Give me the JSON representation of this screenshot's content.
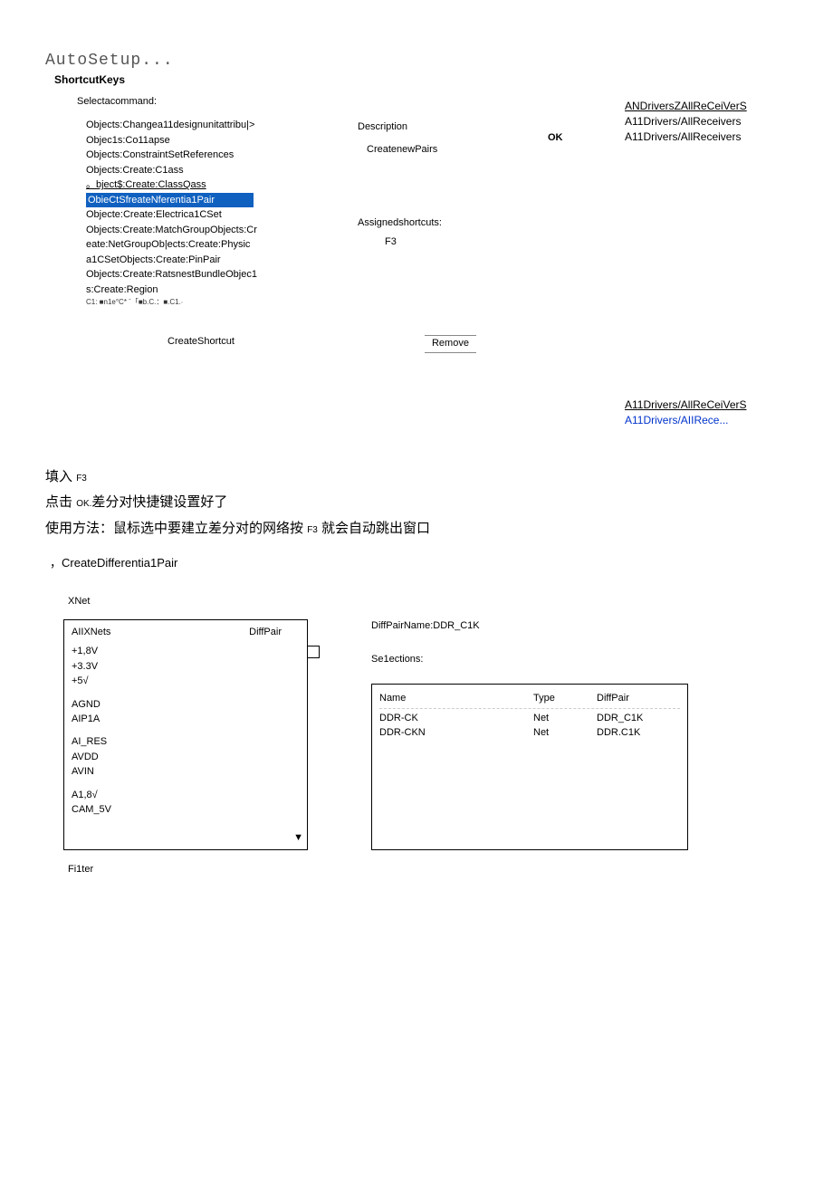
{
  "header": {
    "autosetup": "AutoSetup...",
    "shortcutkeys": "ShortcutKeys"
  },
  "sidebar1": {
    "l1": "ANDriversZAllReCeiVerS",
    "l2": "A11Drivers/AllReceivers",
    "l3": "A11Drivers/AllReceivers"
  },
  "dialog": {
    "select_label": "Selectacommand:",
    "cmds": {
      "c1": "Objects:Changea11designunitattribu|>",
      "c2": "Objec1s:Co11apse",
      "c3": "Objects:ConstraintSetReferences",
      "c4": "Objects:Create:C1ass",
      "c5": "。bject$:Create:ClassQass",
      "c6": "ObieCtSfreateNferentia1Pair",
      "c7": "Objecte:Create:Electrica1CSet",
      "c8": "Objects:Create:MatchGroupObjects:Cr",
      "c9": "eate:NetGroupOb|ects:Create:Physic",
      "c10": "a1CSetObjects:Create:PinPair",
      "c11": "Objects:Create:RatsnestBundleObjec1",
      "c12": "s:Create:Region",
      "c13": "C1: ■n1e°C* ˉ「■b.C.：■.C1.∙"
    },
    "desc_label": "Description",
    "desc_body": "CreatenewPairs",
    "assigned_label": "Assignedshortcuts:",
    "assigned_val": "F3",
    "ok": "OK",
    "create_btn": "CreateShortcut",
    "remove_btn": "Remove"
  },
  "sidebar2": {
    "l1": "A11Drivers/AllReCeiVerS",
    "l2": "A11Drivers/AIIRece..."
  },
  "prose": {
    "p1a": "填入",
    "p1b": "F3",
    "p2a": "点击",
    "p2b": "OK.",
    "p2c": "差分对快捷键设置好了",
    "p3a": "使用方法：鼠标选中要建立差分对的网络按",
    "p3b": "F3",
    "p3c": "就会自动跳出窗口",
    "subtitle": "，CreateDifferentia1Pair"
  },
  "xnet": {
    "label": "XNet",
    "head_left": "AIIXNets",
    "head_right": "DiffPair",
    "items": [
      "+1,8V",
      "+3.3V",
      "+5√",
      "",
      "AGND",
      "AIP1A",
      "",
      "AI_RES",
      "AVDD",
      "AVIN",
      "",
      "A1,8√",
      "CAM_5V"
    ],
    "scroll_marker": "▼",
    "filter": "Fi1ter"
  },
  "right": {
    "dpn": "DiffPairName:DDR_C1K",
    "selections": "Se1ections:",
    "head": {
      "c1": "Name",
      "c2": "Type",
      "c3": "DiffPair"
    },
    "rows": [
      {
        "c1": "DDR-CK",
        "c2": "Net",
        "c3": "DDR_C1K"
      },
      {
        "c1": "DDR-CKN",
        "c2": "Net",
        "c3": "DDR.C1K"
      }
    ]
  }
}
